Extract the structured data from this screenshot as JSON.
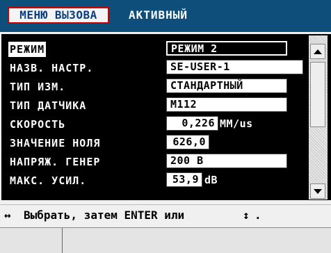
{
  "header": {
    "menu_tab": "МЕНЮ ВЫЗОВА",
    "status": "АКТИВНЫЙ",
    "background_color": "#0d4f7a"
  },
  "settings": [
    {
      "label": "РЕЖИМ",
      "value": "РЕЖИМ 2",
      "unit": "",
      "selected": true
    },
    {
      "label": "НАЗВ. НАСТР.",
      "value": "SE-USER-1",
      "unit": ""
    },
    {
      "label": "ТИП ИЗМ.",
      "value": "СТАНДАРТНЫЙ",
      "unit": ""
    },
    {
      "label": "ТИП ДАТЧИКА",
      "value": "M112",
      "unit": ""
    },
    {
      "label": "СКОРОСТЬ",
      "value": "0,226",
      "unit": "MM/us"
    },
    {
      "label": "ЗНАЧЕНИЕ НОЛЯ",
      "value": "626,0",
      "unit": ""
    },
    {
      "label": "НАПРЯЖ. ГЕНЕР",
      "value": "200 В",
      "unit": ""
    },
    {
      "label": "МАКС. УСИЛ.",
      "value": "53,9",
      "unit": "dB"
    }
  ],
  "scrollbar": {
    "up_icon": "arrow-up-icon",
    "down_icon": "arrow-down-icon"
  },
  "help": {
    "arrow_glyph": "↔",
    "text": "Выбрать, затем ENTER или",
    "updown_glyph": "↕",
    "end": "."
  }
}
